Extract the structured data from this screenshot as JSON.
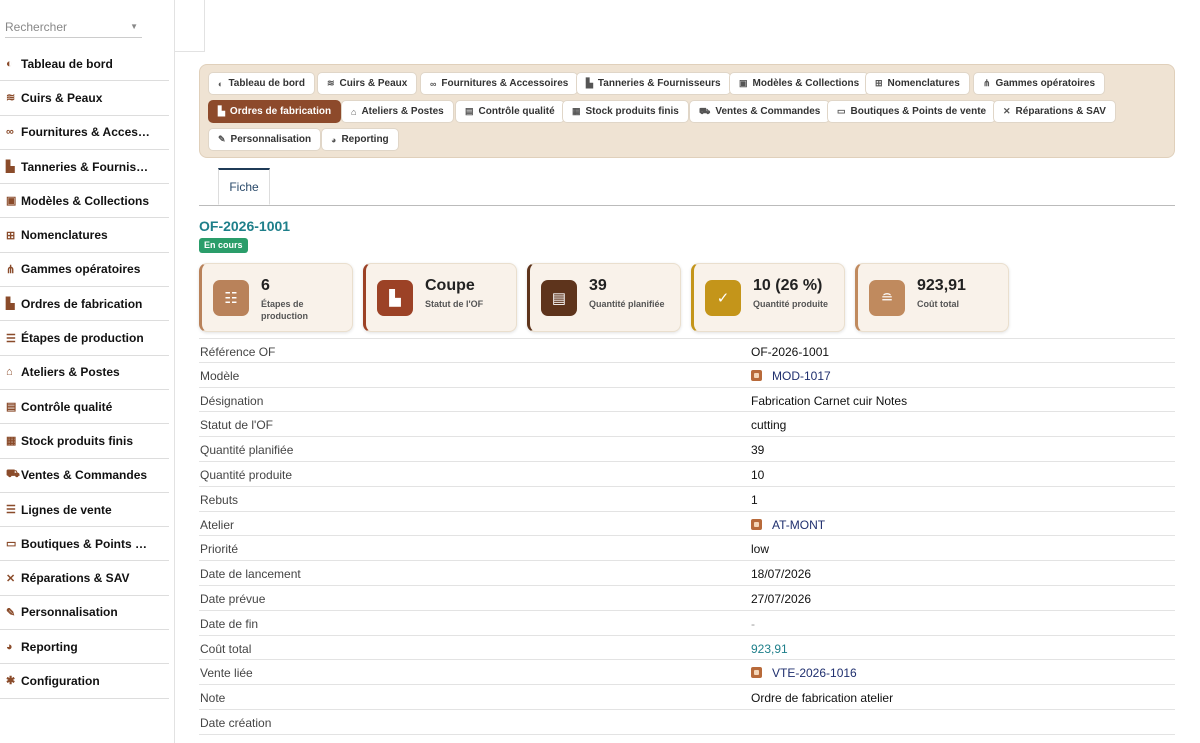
{
  "search": {
    "placeholder": "Rechercher"
  },
  "sidebar": {
    "items": [
      {
        "label": "Tableau de bord",
        "icon": "gauge-icon",
        "glyph": "◐"
      },
      {
        "label": "Cuirs & Peaux",
        "icon": "layers-icon",
        "glyph": "≋"
      },
      {
        "label": "Fournitures & Acces…",
        "icon": "link-icon",
        "glyph": "∞"
      },
      {
        "label": "Tanneries & Fournis…",
        "icon": "industry-icon",
        "glyph": "▙"
      },
      {
        "label": "Modèles & Collections",
        "icon": "bag-icon",
        "glyph": "▣"
      },
      {
        "label": "Nomenclatures",
        "icon": "sitemap-icon",
        "glyph": "⊞"
      },
      {
        "label": "Gammes opératoires",
        "icon": "route-icon",
        "glyph": "⋔"
      },
      {
        "label": "Ordres de fabrication",
        "icon": "industry-icon",
        "glyph": "▙"
      },
      {
        "label": "Étapes de production",
        "icon": "list-check-icon",
        "glyph": "☰"
      },
      {
        "label": "Ateliers & Postes",
        "icon": "workshop-icon",
        "glyph": "⌂"
      },
      {
        "label": "Contrôle qualité",
        "icon": "clipboard-check-icon",
        "glyph": "▤"
      },
      {
        "label": "Stock produits finis",
        "icon": "warehouse-icon",
        "glyph": "▦"
      },
      {
        "label": "Ventes & Commandes",
        "icon": "cart-icon",
        "glyph": "⛟"
      },
      {
        "label": "Lignes de vente",
        "icon": "list-icon",
        "glyph": "☰"
      },
      {
        "label": "Boutiques & Points …",
        "icon": "store-icon",
        "glyph": "▭"
      },
      {
        "label": "Réparations & SAV",
        "icon": "tools-icon",
        "glyph": "✕"
      },
      {
        "label": "Personnalisation",
        "icon": "pen-icon",
        "glyph": "✎"
      },
      {
        "label": "Reporting",
        "icon": "pie-chart-icon",
        "glyph": "◕"
      },
      {
        "label": "Configuration",
        "icon": "gear-icon",
        "glyph": "✱"
      }
    ]
  },
  "tabs": [
    {
      "label": "Tableau de bord",
      "glyph": "◐",
      "active": false
    },
    {
      "label": "Cuirs & Peaux",
      "glyph": "≋",
      "active": false
    },
    {
      "label": "Fournitures & Accessoires",
      "glyph": "∞",
      "active": false
    },
    {
      "label": "Tanneries & Fournisseurs",
      "glyph": "▙",
      "active": false
    },
    {
      "label": "Modèles & Collections",
      "glyph": "▣",
      "active": false
    },
    {
      "label": "Nomenclatures",
      "glyph": "⊞",
      "active": false
    },
    {
      "label": "Gammes opératoires",
      "glyph": "⋔",
      "active": false
    },
    {
      "label": "Ordres de fabrication",
      "glyph": "▙",
      "active": true
    },
    {
      "label": "Ateliers & Postes",
      "glyph": "⌂",
      "active": false
    },
    {
      "label": "Contrôle qualité",
      "glyph": "▤",
      "active": false
    },
    {
      "label": "Stock produits finis",
      "glyph": "▦",
      "active": false
    },
    {
      "label": "Ventes & Commandes",
      "glyph": "⛟",
      "active": false
    },
    {
      "label": "Boutiques & Points de vente",
      "glyph": "▭",
      "active": false
    },
    {
      "label": "Réparations & SAV",
      "glyph": "✕",
      "active": false
    },
    {
      "label": "Personnalisation",
      "glyph": "✎",
      "active": false
    },
    {
      "label": "Reporting",
      "glyph": "◕",
      "active": false
    }
  ],
  "subtab": {
    "label": "Fiche"
  },
  "record": {
    "id": "OF-2026-1001",
    "status_badge": "En cours"
  },
  "kpis": [
    {
      "value": "6",
      "label": "Étapes de production",
      "icon": "list-check-icon",
      "glyph": "☷",
      "color": "#b9825a"
    },
    {
      "value": "Coupe",
      "label": "Statut de l'OF",
      "icon": "industry-icon",
      "glyph": "▙",
      "color": "#9c4226"
    },
    {
      "value": "39",
      "label": "Quantité planifiée",
      "icon": "clipboard-icon",
      "glyph": "▤",
      "color": "#5e341c"
    },
    {
      "value": "10 (26 %)",
      "label": "Quantité produite",
      "icon": "check-circle-icon",
      "glyph": "✓",
      "color": "#c4951a"
    },
    {
      "value": "923,91",
      "label": "Coût total",
      "icon": "coins-icon",
      "glyph": "≘",
      "color": "#c08a5e"
    }
  ],
  "fields": [
    {
      "key": "Référence OF",
      "value": "OF-2026-1001",
      "style": ""
    },
    {
      "key": "Modèle",
      "value": "MOD-1017",
      "style": "link"
    },
    {
      "key": "Désignation",
      "value": "Fabrication Carnet cuir Notes",
      "style": ""
    },
    {
      "key": "Statut de l'OF",
      "value": "cutting",
      "style": ""
    },
    {
      "key": "Quantité planifiée",
      "value": "39",
      "style": ""
    },
    {
      "key": "Quantité produite",
      "value": "10",
      "style": ""
    },
    {
      "key": "Rebuts",
      "value": "1",
      "style": ""
    },
    {
      "key": "Atelier",
      "value": "AT-MONT",
      "style": "link"
    },
    {
      "key": "Priorité",
      "value": "low",
      "style": ""
    },
    {
      "key": "Date de lancement",
      "value": "18/07/2026",
      "style": ""
    },
    {
      "key": "Date prévue",
      "value": "27/07/2026",
      "style": ""
    },
    {
      "key": "Date de fin",
      "value": "-",
      "style": "muted"
    },
    {
      "key": "Coût total",
      "value": "923,91",
      "style": "teal"
    },
    {
      "key": "Vente liée",
      "value": "VTE-2026-1016",
      "style": "link"
    },
    {
      "key": "Note",
      "value": "Ordre de fabrication atelier",
      "style": ""
    },
    {
      "key": "Date création",
      "value": "",
      "style": ""
    }
  ],
  "colors": {
    "accent": "#8d4a2b",
    "teal": "#1e7f8a",
    "success": "#2a9d6a",
    "tabbar_bg": "#efe3d3"
  }
}
